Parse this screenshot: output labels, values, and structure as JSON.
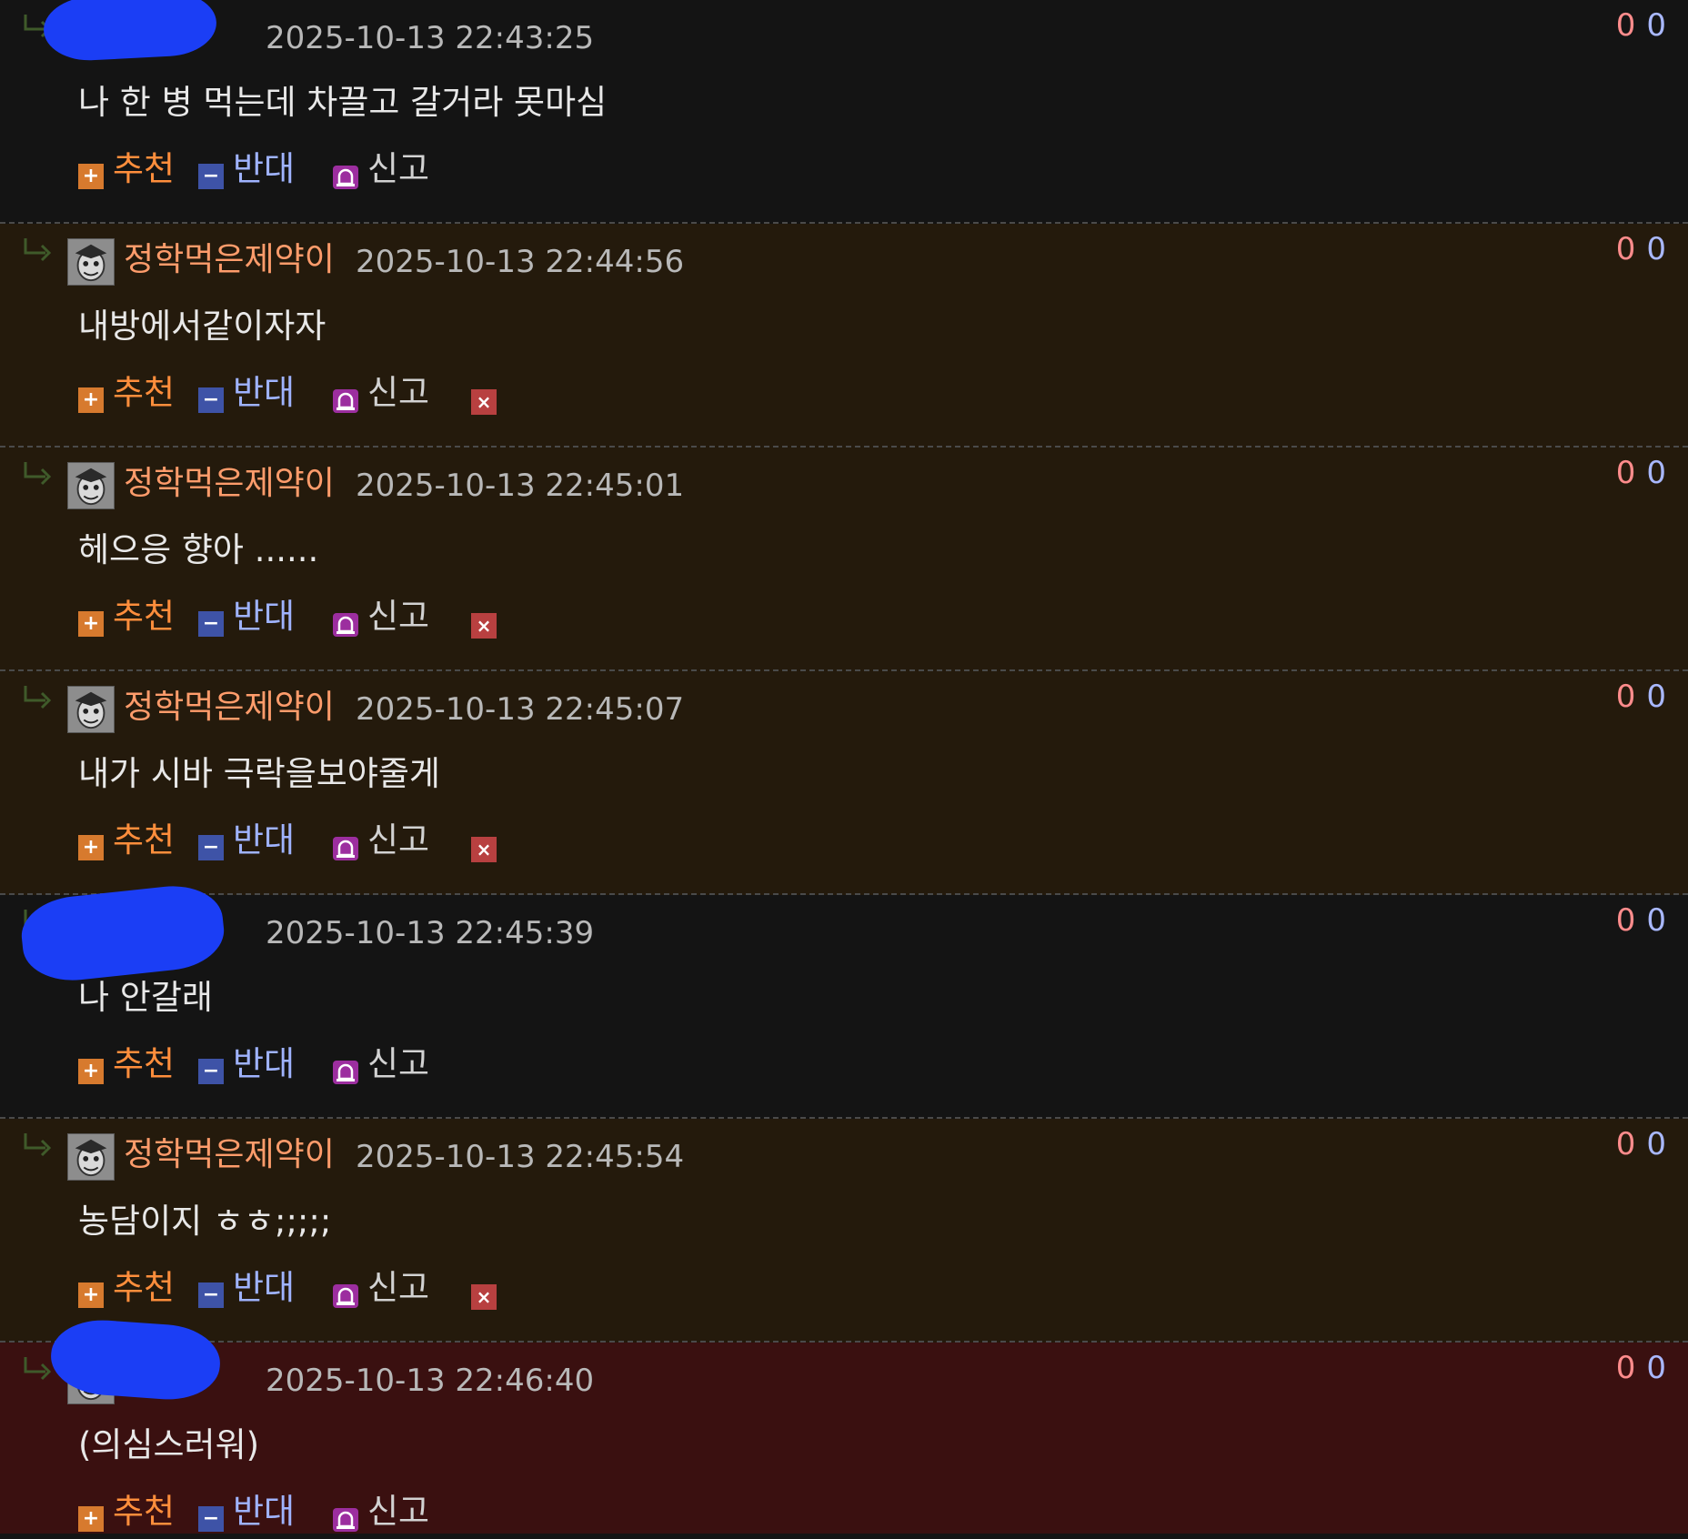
{
  "labels": {
    "recommend": "추천",
    "oppose": "반대",
    "report": "신고",
    "plus_sign": "+",
    "minus_sign": "−",
    "delete_sign": "×"
  },
  "colors": {
    "author_accent": "#ff9c6b",
    "recommend": "#ff8e3c",
    "oppose": "#9fb3ff",
    "vote_up": "#ff8c8c",
    "vote_down": "#a9b8ff"
  },
  "comments": [
    {
      "author": "",
      "author_redacted": true,
      "has_avatar": false,
      "time": "2025-10-13 22:43:25",
      "votes_up": "0",
      "votes_down": "0",
      "text": "나 한 병 먹는데 차끌고 갈거라 못마심",
      "deletable": false,
      "background": "#141414"
    },
    {
      "author": "정학먹은제약이",
      "author_redacted": false,
      "has_avatar": true,
      "time": "2025-10-13 22:44:56",
      "votes_up": "0",
      "votes_down": "0",
      "text": "내방에서같이자자",
      "deletable": true,
      "background": "#241a0c"
    },
    {
      "author": "정학먹은제약이",
      "author_redacted": false,
      "has_avatar": true,
      "time": "2025-10-13 22:45:01",
      "votes_up": "0",
      "votes_down": "0",
      "text": "헤으응 향아 ......",
      "deletable": true,
      "background": "#241a0c"
    },
    {
      "author": "정학먹은제약이",
      "author_redacted": false,
      "has_avatar": true,
      "time": "2025-10-13 22:45:07",
      "votes_up": "0",
      "votes_down": "0",
      "text": "내가 시바 극락을보야줄게",
      "deletable": true,
      "background": "#241a0c"
    },
    {
      "author": "",
      "author_redacted": true,
      "has_avatar": false,
      "time": "2025-10-13 22:45:39",
      "votes_up": "0",
      "votes_down": "0",
      "text": "나 안갈래",
      "deletable": false,
      "background": "#141414"
    },
    {
      "author": "정학먹은제약이",
      "author_redacted": false,
      "has_avatar": true,
      "time": "2025-10-13 22:45:54",
      "votes_up": "0",
      "votes_down": "0",
      "text": "농담이지 ㅎㅎ;;;;;",
      "deletable": true,
      "background": "#241a0c"
    },
    {
      "author": "",
      "author_redacted": true,
      "has_avatar": true,
      "time": "2025-10-13 22:46:40",
      "votes_up": "0",
      "votes_down": "0",
      "text": "(의심스러워)",
      "deletable": false,
      "background": "#3a1010"
    }
  ]
}
